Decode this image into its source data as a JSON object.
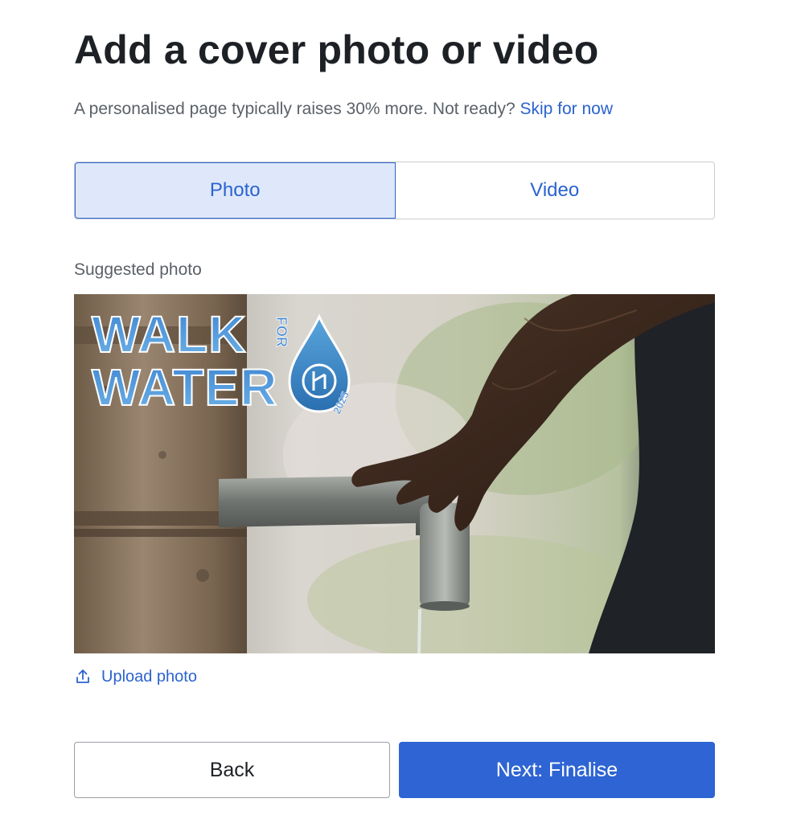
{
  "header": {
    "title": "Add a cover photo or video",
    "subtitle": "A personalised page typically raises 30% more. Not ready?",
    "skip_link": "Skip for now"
  },
  "media_toggle": {
    "options": [
      {
        "label": "Photo",
        "selected": true
      },
      {
        "label": "Video",
        "selected": false
      }
    ]
  },
  "suggested": {
    "label": "Suggested photo",
    "logo": {
      "line1": "WALK",
      "line2": "WATER",
      "for": "FOR",
      "year": "2025"
    }
  },
  "upload": {
    "label": "Upload photo",
    "icon": "upload-icon"
  },
  "footer": {
    "back_label": "Back",
    "next_label": "Next: Finalise"
  },
  "colors": {
    "accent": "#2e64d3",
    "link": "#2b63cf",
    "selected_bg": "#dfe8fb",
    "title": "#1d2125",
    "muted": "#5b6167"
  }
}
